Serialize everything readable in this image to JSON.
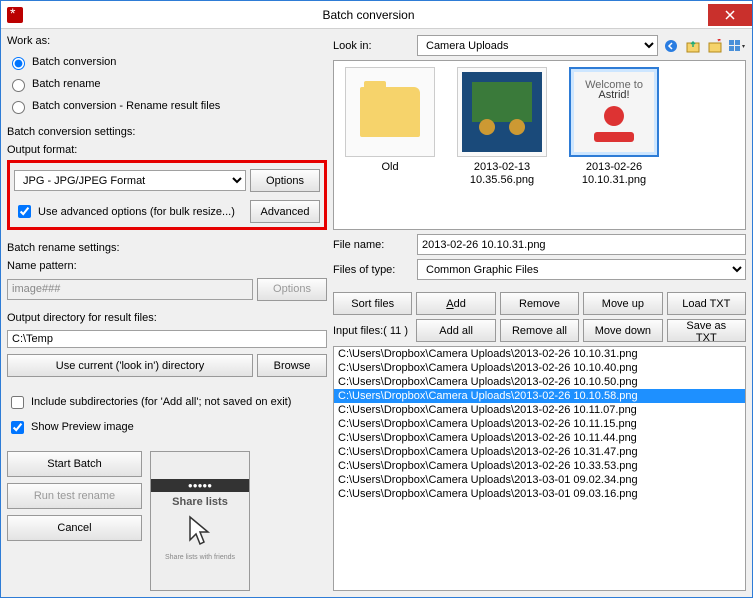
{
  "title": "Batch conversion",
  "left": {
    "work_as_label": "Work as:",
    "radios": {
      "batch_conversion": "Batch conversion",
      "batch_rename": "Batch rename",
      "batch_conversion_rename": "Batch conversion - Rename result files"
    },
    "settings_label": "Batch conversion settings:",
    "output_format_label": "Output format:",
    "output_format_value": "JPG - JPG/JPEG Format",
    "options_btn": "Options",
    "use_advanced_label": "Use advanced options (for bulk resize...)",
    "advanced_btn": "Advanced",
    "rename_settings_label": "Batch rename settings:",
    "name_pattern_label": "Name pattern:",
    "name_pattern_value": "image###",
    "rename_options_btn": "Options",
    "output_dir_label": "Output directory for result files:",
    "output_dir_value": "C:\\Temp",
    "use_current_btn": "Use current ('look in') directory",
    "browse_btn": "Browse",
    "include_subdirs_label": "Include subdirectories (for 'Add all'; not saved on exit)",
    "show_preview_label": "Show Preview image",
    "start_batch_btn": "Start Batch",
    "run_test_btn": "Run test rename",
    "cancel_btn": "Cancel",
    "preview_caption": "Share lists"
  },
  "right": {
    "look_in_label": "Look in:",
    "look_in_value": "Camera Uploads",
    "thumbs": [
      {
        "label": "Old",
        "type": "folder"
      },
      {
        "label": "2013-02-13 10.35.56.png",
        "type": "image"
      },
      {
        "label": "2013-02-26 10.10.31.png",
        "type": "image",
        "selected": true
      }
    ],
    "file_name_label": "File name:",
    "file_name_value": "2013-02-26 10.10.31.png",
    "files_of_type_label": "Files of type:",
    "files_of_type_value": "Common Graphic Files",
    "buttons": {
      "sort_files": "Sort files",
      "add": "Add",
      "remove": "Remove",
      "move_up": "Move up",
      "load_txt": "Load TXT",
      "add_all": "Add all",
      "remove_all": "Remove all",
      "move_down": "Move down",
      "save_txt": "Save as TXT"
    },
    "input_files_label": "Input files:( 11 )",
    "file_list": [
      "C:\\Users\\Dropbox\\Camera Uploads\\2013-02-26 10.10.31.png",
      "C:\\Users\\Dropbox\\Camera Uploads\\2013-02-26 10.10.40.png",
      "C:\\Users\\Dropbox\\Camera Uploads\\2013-02-26 10.10.50.png",
      "C:\\Users\\Dropbox\\Camera Uploads\\2013-02-26 10.10.58.png",
      "C:\\Users\\Dropbox\\Camera Uploads\\2013-02-26 10.11.07.png",
      "C:\\Users\\Dropbox\\Camera Uploads\\2013-02-26 10.11.15.png",
      "C:\\Users\\Dropbox\\Camera Uploads\\2013-02-26 10.11.44.png",
      "C:\\Users\\Dropbox\\Camera Uploads\\2013-02-26 10.31.47.png",
      "C:\\Users\\Dropbox\\Camera Uploads\\2013-02-26 10.33.53.png",
      "C:\\Users\\Dropbox\\Camera Uploads\\2013-03-01 09.02.34.png",
      "C:\\Users\\Dropbox\\Camera Uploads\\2013-03-01 09.03.16.png"
    ],
    "selected_index": 3
  }
}
